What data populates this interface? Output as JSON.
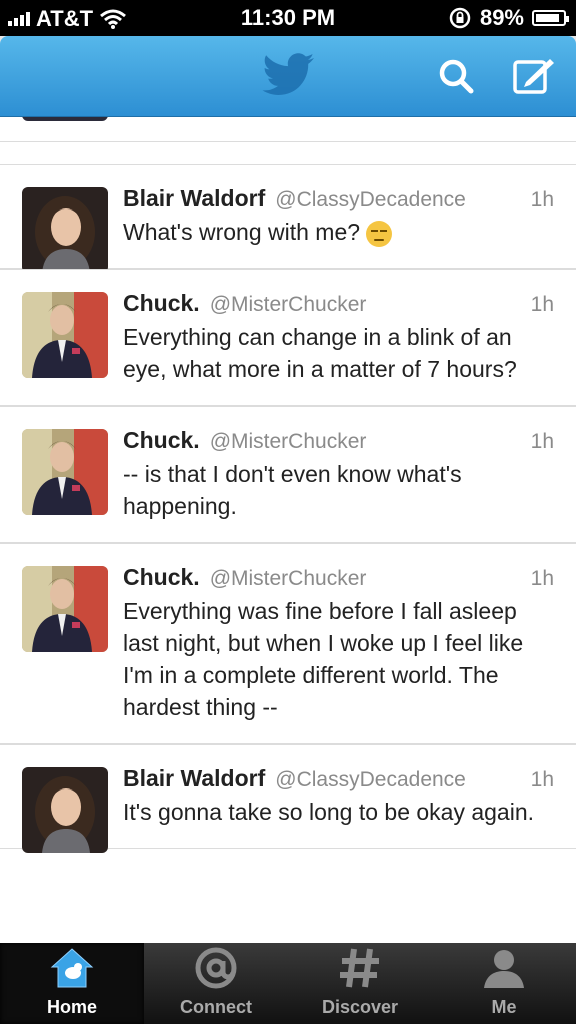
{
  "status_bar": {
    "carrier": "AT&T",
    "time": "11:30 PM",
    "battery": "89%",
    "battery_level": 0.89,
    "icons": [
      "signal-icon",
      "wifi-icon",
      "rotation-lock-icon",
      "battery-icon"
    ]
  },
  "nav": {
    "icons": [
      "twitter-bird-icon",
      "search-icon",
      "compose-icon"
    ],
    "accent": "#2d8fd3"
  },
  "tweets": [
    {
      "name": "Blair Waldorf",
      "handle": "@ClassyDecadence",
      "time": "1h",
      "text": "What's wrong with me?",
      "emoji": "pensive-face-icon"
    },
    {
      "name": "Chuck.",
      "handle": "@MisterChucker",
      "time": "1h",
      "text": "Everything can change in a blink of an eye, what more in a matter of 7 hours?"
    },
    {
      "name": "Chuck.",
      "handle": "@MisterChucker",
      "time": "1h",
      "text": "-- is that I don't even know what's happening."
    },
    {
      "name": "Chuck.",
      "handle": "@MisterChucker",
      "time": "1h",
      "text": "Everything was fine before I fall asleep last night, but when I woke up I feel like I'm in a complete different world. The hardest thing --"
    },
    {
      "name": "Blair Waldorf",
      "handle": "@ClassyDecadence",
      "time": "1h",
      "text": "It's gonna take so long to be okay again."
    }
  ],
  "tabs": [
    {
      "label": "Home",
      "icon": "home-icon",
      "active": true
    },
    {
      "label": "Connect",
      "icon": "at-sign-icon",
      "active": false
    },
    {
      "label": "Discover",
      "icon": "hashtag-icon",
      "active": false
    },
    {
      "label": "Me",
      "icon": "person-icon",
      "active": false
    }
  ]
}
